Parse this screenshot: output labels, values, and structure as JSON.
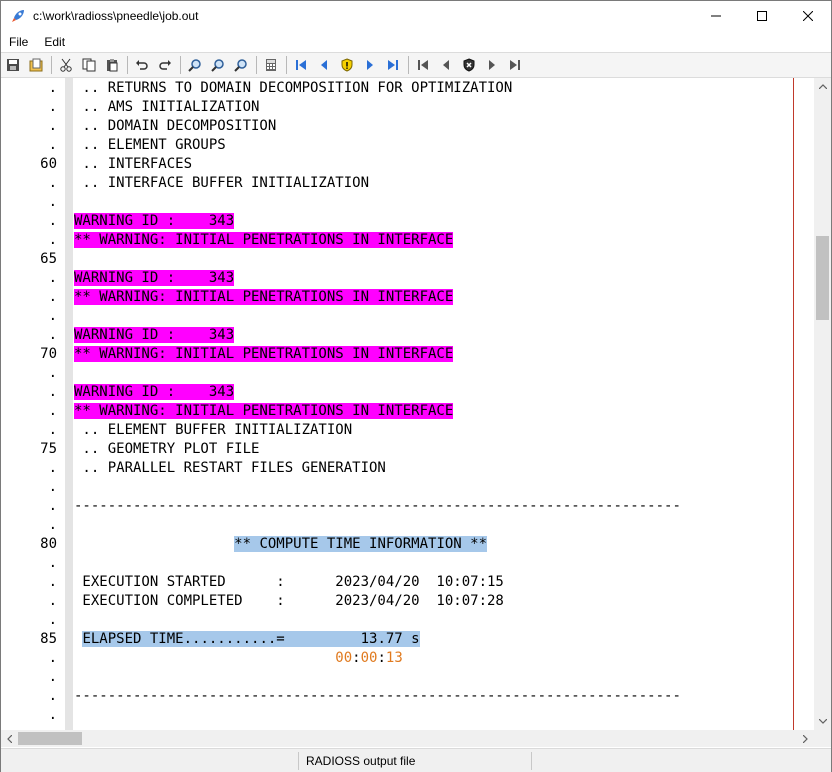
{
  "window": {
    "title": "c:\\work\\radioss\\pneedle\\job.out"
  },
  "menu": [
    "File",
    "Edit"
  ],
  "gutter": [
    ".",
    ".",
    ".",
    ".",
    "60",
    ".",
    ".",
    ".",
    ".",
    "65",
    ".",
    ".",
    ".",
    ".",
    "70",
    ".",
    ".",
    ".",
    ".",
    "75",
    ".",
    ".",
    ".",
    ".",
    "80",
    ".",
    ".",
    ".",
    ".",
    "85",
    ".",
    ".",
    ".",
    ".",
    "."
  ],
  "lines": [
    " .. RETURNS TO DOMAIN DECOMPOSITION FOR OPTIMIZATION",
    " .. AMS INITIALIZATION",
    " .. DOMAIN DECOMPOSITION",
    " .. ELEMENT GROUPS",
    " .. INTERFACES",
    " .. INTERFACE BUFFER INITIALIZATION",
    "",
    "WARNING ID :    343",
    "** WARNING: INITIAL PENETRATIONS IN INTERFACE",
    "",
    "WARNING ID :    343",
    "** WARNING: INITIAL PENETRATIONS IN INTERFACE",
    "",
    "WARNING ID :    343",
    "** WARNING: INITIAL PENETRATIONS IN INTERFACE",
    "",
    "WARNING ID :    343",
    "** WARNING: INITIAL PENETRATIONS IN INTERFACE",
    " .. ELEMENT BUFFER INITIALIZATION",
    " .. GEOMETRY PLOT FILE",
    " .. PARALLEL RESTART FILES GENERATION",
    "",
    "------------------------------------------------------------------------",
    "",
    "                   ** COMPUTE TIME INFORMATION **",
    "",
    " EXECUTION STARTED      :      2023/04/20  10:07:15",
    " EXECUTION COMPLETED    :      2023/04/20  10:07:28",
    "",
    " ELAPSED TIME...........=         13.77 s",
    "",
    "",
    "------------------------------------------------------------------------"
  ],
  "elapsed_clock": {
    "h": "00",
    "m": "00",
    "s": "13",
    "sep": ":"
  },
  "status": {
    "text": "RADIOSS output file"
  },
  "colors": {
    "warning_highlight": "#ff00ff",
    "selection_highlight": "#a6c8ea",
    "clock": "#e07a1f",
    "right_rule": "#c0392b"
  },
  "scroll": {
    "vertical_position": 0.25
  }
}
